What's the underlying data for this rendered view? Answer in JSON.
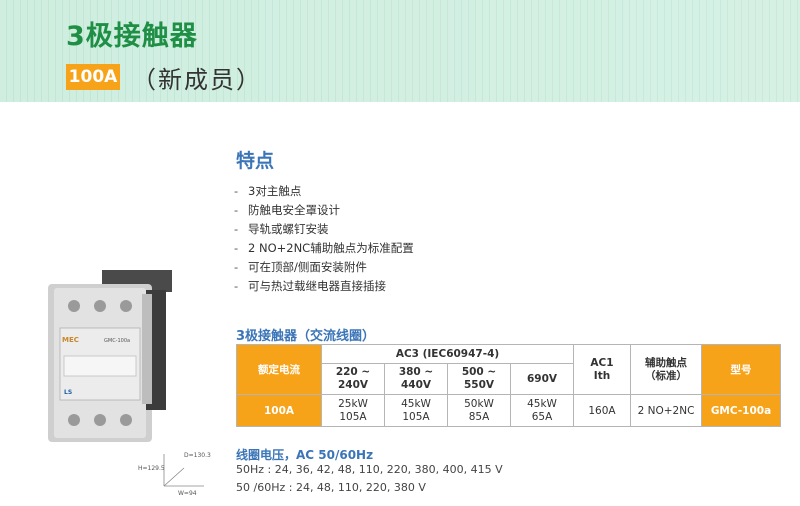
{
  "header": {
    "title": "3极接触器",
    "amp_badge": "100A",
    "subtitle": "（新成员）"
  },
  "features": {
    "title": "特点",
    "items": [
      "3对主触点",
      "防触电安全罩设计",
      "导轨或螺钉安装",
      "2 NO+2NC辅助触点为标准配置",
      "可在顶部/侧面安装附件",
      "可与热过载继电器直接插接"
    ]
  },
  "table": {
    "title": "3极接触器（交流线圈）",
    "header": {
      "rated_current": "额定电流",
      "ac3": "AC3 (IEC60947-4)",
      "ac1_line1": "AC1",
      "ac1_line2": "Ith",
      "aux_line1": "辅助触点",
      "aux_line2": "（标准）",
      "model": "型号"
    },
    "voltages": [
      {
        "line1": "220 ~",
        "line2": "240V"
      },
      {
        "line1": "380 ~",
        "line2": "440V"
      },
      {
        "line1": "500 ~",
        "line2": "550V"
      },
      {
        "line1": "690V",
        "line2": ""
      }
    ],
    "row": {
      "rated_current": "100A",
      "cells": [
        {
          "kw": "25kW",
          "a": "105A"
        },
        {
          "kw": "45kW",
          "a": "105A"
        },
        {
          "kw": "50kW",
          "a": "85A"
        },
        {
          "kw": "45kW",
          "a": "65A"
        }
      ],
      "ac1": "160A",
      "aux": "2 NO+2NC",
      "model": "GMC-100a"
    }
  },
  "coil": {
    "title": "线圈电压，AC 50/60Hz",
    "line1": "50Hz : 24, 36, 42, 48, 110, 220, 380, 400, 415 V",
    "line2": "50 /60Hz : 24, 48, 110, 220, 380 V"
  },
  "product": {
    "brand_label": "MEC",
    "model_label": "GMC-100a",
    "logo_label": "LS"
  },
  "dimensions": {
    "d": "D=130.3",
    "h": "H=129.5",
    "w": "W=94"
  },
  "colors": {
    "title_green": "#1e8f45",
    "accent_orange": "#f7a319",
    "heading_blue": "#3b75b8",
    "header_band": "#cfeee0"
  }
}
